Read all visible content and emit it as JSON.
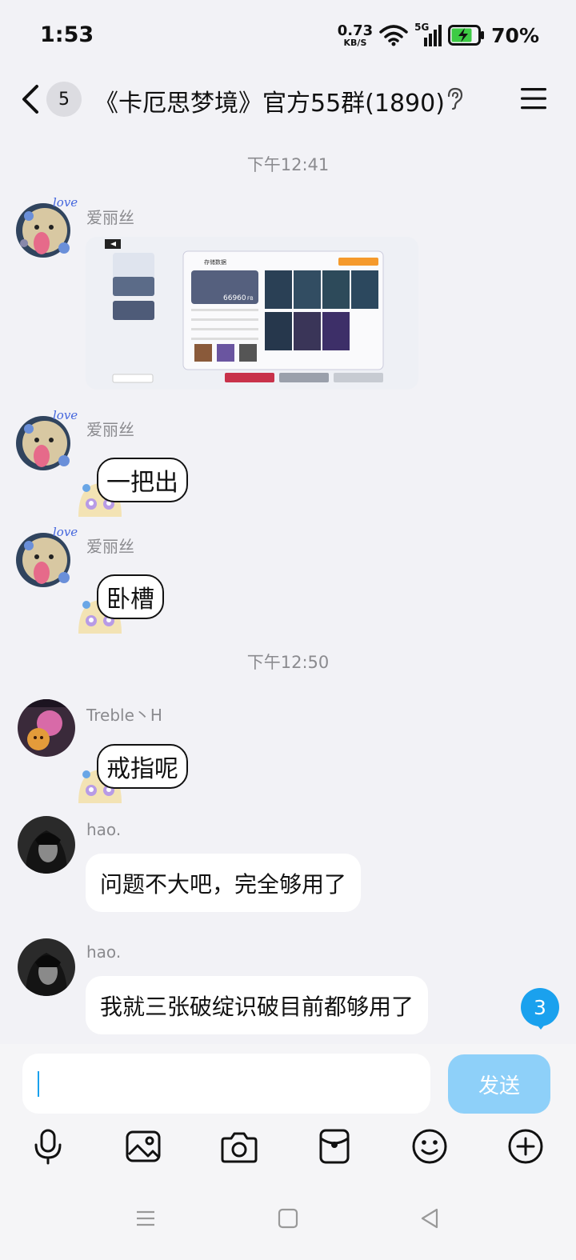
{
  "status_bar": {
    "time": "1:53",
    "net_speed_value": "0.73",
    "net_speed_unit": "KB/S",
    "network": "5G",
    "battery": "70%"
  },
  "header": {
    "unread_count": "5",
    "title": "《卡厄思梦境》官方55群(1890)"
  },
  "messages": [
    {
      "type": "timestamp",
      "text": "下午12:41"
    },
    {
      "type": "image",
      "sender": "爱丽丝",
      "image_text": {
        "title": "存储数据",
        "value": "66960",
        "unit": "FB"
      }
    },
    {
      "type": "sticker",
      "sender": "爱丽丝",
      "text": "一把出"
    },
    {
      "type": "sticker",
      "sender": "爱丽丝",
      "text": "卧槽"
    },
    {
      "type": "timestamp",
      "text": "下午12:50"
    },
    {
      "type": "sticker",
      "sender": "Treble丶H",
      "text": "戒指呢"
    },
    {
      "type": "text",
      "sender": "hao.",
      "text": "问题不大吧，完全够用了"
    },
    {
      "type": "text",
      "sender": "hao.",
      "text": "我就三张破绽识破目前都够用了"
    }
  ],
  "new_message_badge": "3",
  "composer": {
    "value": "",
    "send_label": "发送"
  },
  "toolbar": {
    "icons": [
      "microphone-icon",
      "image-icon",
      "camera-icon",
      "red-packet-icon",
      "emoji-icon",
      "plus-icon"
    ]
  },
  "colors": {
    "accent": "#1aa1ee",
    "send_disabled": "#8ed0f9",
    "background": "#f2f2f6"
  }
}
